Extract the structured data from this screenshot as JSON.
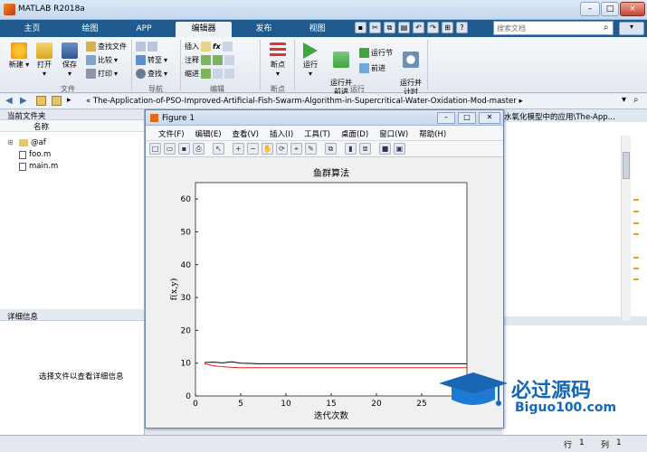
{
  "window": {
    "title": "MATLAB R2018a",
    "buttons": [
      "–",
      "□",
      "×"
    ]
  },
  "tabs": [
    {
      "label": "主页",
      "active": false
    },
    {
      "label": "绘图",
      "active": false
    },
    {
      "label": "APP",
      "active": false
    },
    {
      "label": "编辑器",
      "active": true
    },
    {
      "label": "发布",
      "active": false
    },
    {
      "label": "视图",
      "active": false
    }
  ],
  "search": {
    "placeholder": "搜索文档"
  },
  "ribbon": {
    "new": "新建",
    "open": "打开",
    "save": "保存",
    "find_files": "查找文件",
    "compare": "比较",
    "print": "打印",
    "goto": "转至",
    "find": "查找",
    "insert": "插入",
    "comment": "注释",
    "indent": "缩进",
    "fx": "fx",
    "breakpoints": "断点",
    "run": "运行",
    "run_advance": "运行并\n前进",
    "run_section": "运行节",
    "advance": "前进",
    "run_time": "运行并\n计时",
    "sections": {
      "file": "文件",
      "nav": "导航",
      "edit": "编辑",
      "bp": "断点",
      "run": "运行"
    }
  },
  "address": {
    "path": "«  The-Application-of-PSO-Improved-Artificial-Fish-Swarm-Algorithm-in-Supercritical-Water-Oxidation-Mod-master  ▸"
  },
  "right_path": "水氧化模型中的应用\\The-App...",
  "current_folder": {
    "header": "当前文件夹",
    "col_name": "名称",
    "items": [
      "@af",
      "foo.m",
      "main.m"
    ]
  },
  "details": {
    "header": "详细信息",
    "message": "选择文件以查看详细信息"
  },
  "status": {
    "row_label": "行",
    "row": "1",
    "col_label": "列",
    "col": "1"
  },
  "figure": {
    "title": "Figure 1",
    "menu": [
      "文件(F)",
      "编辑(E)",
      "查看(V)",
      "插入(I)",
      "工具(T)",
      "桌面(D)",
      "窗口(W)",
      "帮助(H)"
    ]
  },
  "logo": {
    "name": "必过源码",
    "url": "Biguo100.com"
  },
  "chart_data": {
    "type": "line",
    "title": "鱼群算法",
    "xlabel": "迭代次数",
    "ylabel": "f(x,y)",
    "xlim": [
      0,
      30
    ],
    "ylim": [
      0,
      65
    ],
    "xticks": [
      0,
      5,
      10,
      15,
      20,
      25
    ],
    "yticks": [
      0,
      10,
      20,
      30,
      40,
      50,
      60
    ],
    "x": [
      1,
      2,
      3,
      4,
      5,
      6,
      7,
      8,
      10,
      12,
      15,
      20,
      25,
      30
    ],
    "series": [
      {
        "color": "#000000",
        "values": [
          10.2,
          10.3,
          10.1,
          10.4,
          10.0,
          9.9,
          9.8,
          9.8,
          9.8,
          9.8,
          9.8,
          9.8,
          9.8,
          9.8
        ]
      },
      {
        "color": "#e8221f",
        "values": [
          9.8,
          9.2,
          8.9,
          8.7,
          8.6,
          8.6,
          8.6,
          8.6,
          8.6,
          8.6,
          8.6,
          8.6,
          8.6,
          8.6
        ]
      }
    ],
    "grid": false
  }
}
